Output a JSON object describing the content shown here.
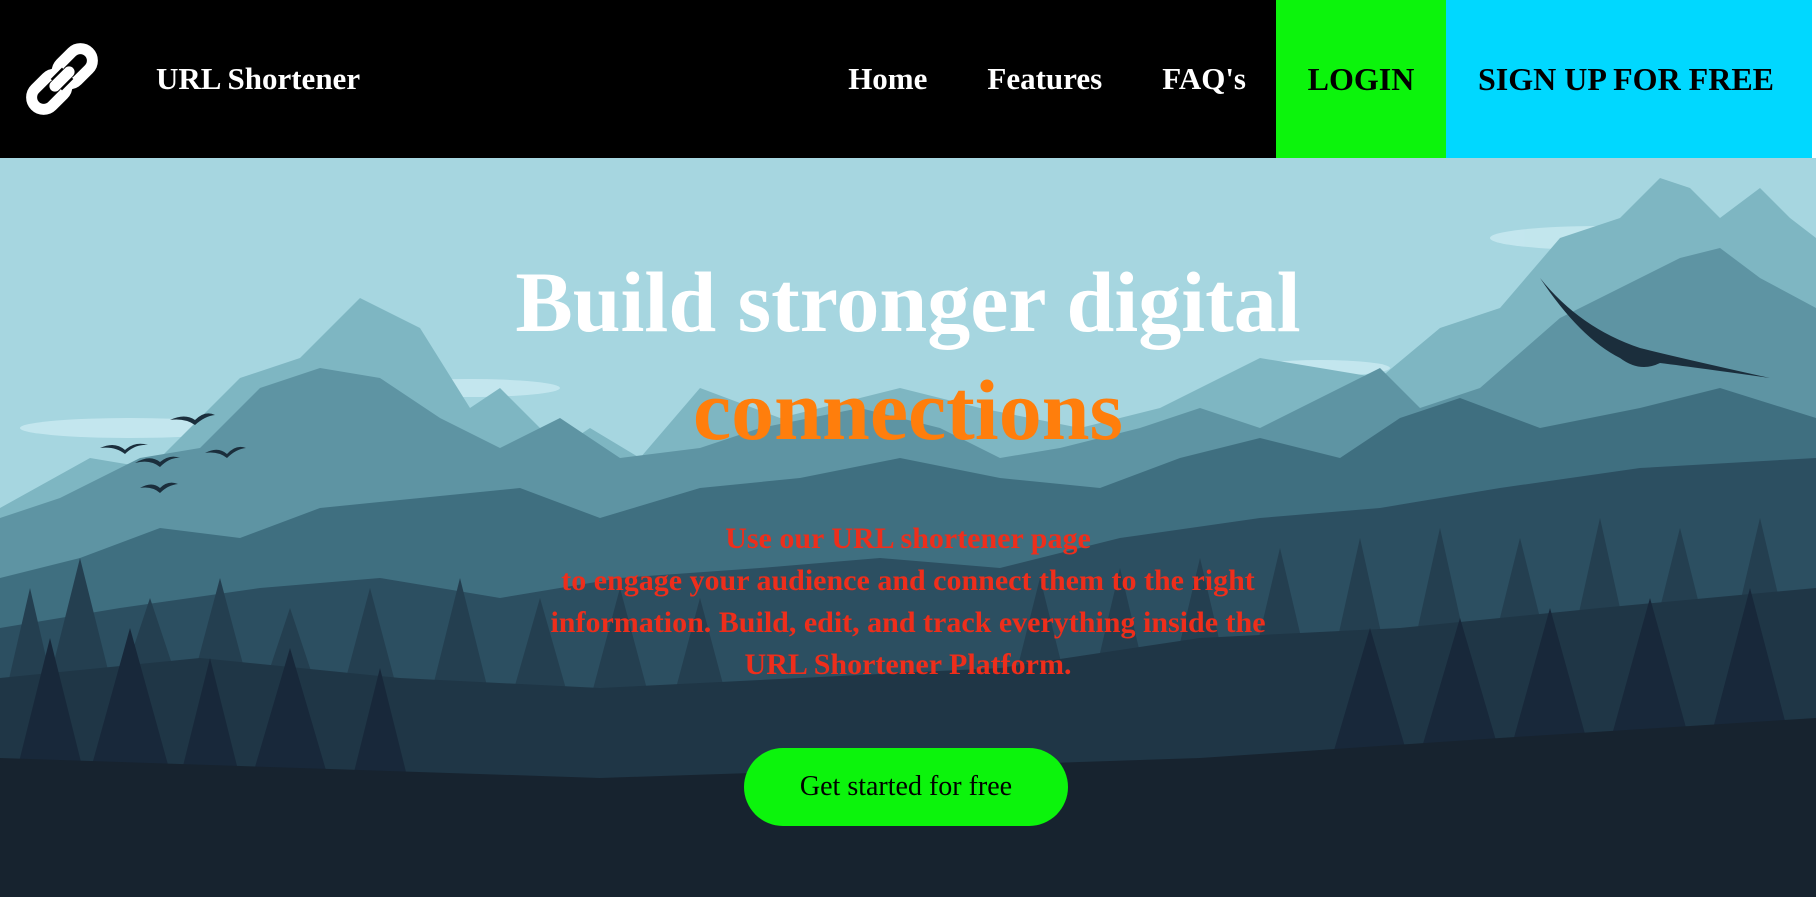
{
  "nav": {
    "brand_name": "URL Shortener",
    "logo_icon": "link-icon",
    "links": [
      {
        "label": "Home"
      },
      {
        "label": "Features"
      },
      {
        "label": "FAQ's"
      }
    ],
    "login_label": "LOGIN",
    "signup_label": "SIGN UP FOR FREE"
  },
  "hero": {
    "headline_line1": "Build stronger digital",
    "headline_line2": "connections",
    "subtext_lines": [
      "Use our URL shortener page",
      "to engage your audience and connect them to the right",
      "information. Build, edit, and track everything inside the",
      "URL Shortener Platform."
    ],
    "cta_label": "Get started for free"
  },
  "colors": {
    "nav_bg": "#000000",
    "login_bg": "#0cf40c",
    "signup_bg": "#00d8ff",
    "headline_accent": "#ff7e0c",
    "subtext": "#ee2e1b",
    "cta_bg": "#0cf40c"
  }
}
